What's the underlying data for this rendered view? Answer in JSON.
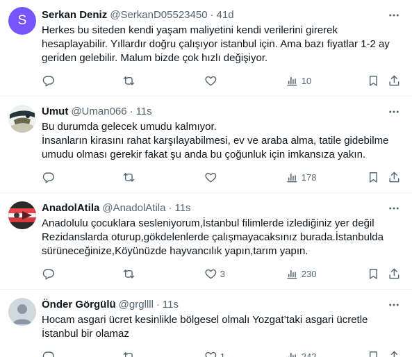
{
  "tweets": [
    {
      "name": "Serkan Deniz",
      "handle": "@SerkanD05523450",
      "time": "41d",
      "avatar_letter": "S",
      "lines": [
        "Herkes bu siteden kendi yaşam maliyetini kendi verilerini girerek",
        "hesaplayabilir. Yıllardır doğru çalışıyor istanbul için. Ama bazı fiyatlar 1-2 ay",
        "geriden gelebilir. Malum bizde çok hızlı değişiyor."
      ],
      "likes": "",
      "views": "10"
    },
    {
      "name": "Umut",
      "handle": "@Uman066",
      "time": "11s",
      "lines": [
        "Bu durumda gelecek umudu kalmıyor.",
        "İnsanların kirasını rahat karşılayabilmesi, ev ve araba alma, tatile gidebilme",
        "umudu olması gerekir fakat şu anda bu çoğunluk için imkansıza yakın."
      ],
      "likes": "",
      "views": "178"
    },
    {
      "name": "AnadolAtila",
      "handle": "@AnadolAtila",
      "time": "11s",
      "lines": [
        "Anadolulu çocuklara sesleniyorum,İstanbul filimlerde izlediğiniz yer değil",
        "Rezidanslarda oturup,gökdelenlerde çalışmayacaksınız burada.İstanbulda",
        "sürüneceğinize,Köyünüzde hayvancılık yapın,tarım yapın."
      ],
      "likes": "3",
      "views": "230"
    },
    {
      "name": "Önder Görgülü",
      "handle": "@grgllll",
      "time": "11s",
      "lines": [
        "Hocam asgari ücret kesinlikle bölgesel olmalı Yozgat’taki asgari ücretle",
        "İstanbul bir olamaz"
      ],
      "likes": "1",
      "views": "242"
    }
  ],
  "icons": {
    "more": "more-icon",
    "reply": "reply-icon",
    "retweet": "retweet-icon",
    "like": "like-icon",
    "views": "views-icon",
    "bookmark": "bookmark-icon",
    "share": "share-icon"
  },
  "colors": {
    "text": "#0f1419",
    "muted": "#536471",
    "divider": "#eff3f4",
    "avatar_purple": "#7856ff"
  }
}
